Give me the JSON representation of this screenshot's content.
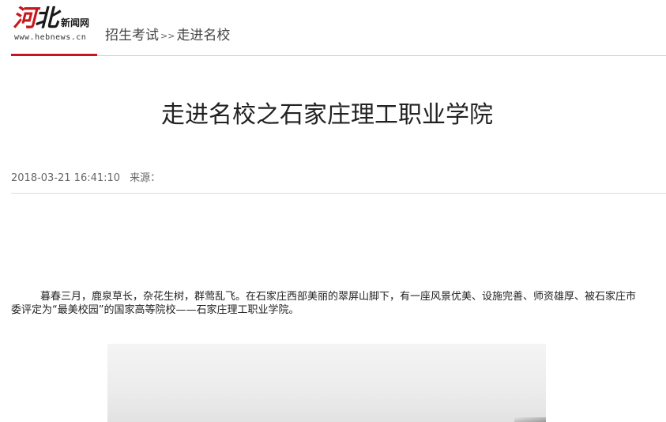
{
  "header": {
    "logo": {
      "mark_part1": "河",
      "mark_part2": "北",
      "sub_label": "新闻网",
      "url": "www.hebnews.cn"
    },
    "breadcrumb": {
      "items": [
        "招生考试",
        "走进名校"
      ],
      "separator": ">>"
    }
  },
  "article": {
    "title": "走进名校之石家庄理工职业学院",
    "date": "2018-03-21 16:41:10",
    "source_label": "来源：",
    "paragraphs": [
      "暮春三月，鹿泉草长，杂花生树，群莺乱飞。在石家庄西部美丽的翠屏山脚下，有一座风景优美、设施完善、师资雄厚、被石家庄市委评定为“最美校园”的国家高等院校——石家庄理工职业学院。"
    ]
  },
  "colors": {
    "brand_red": "#c8161d",
    "divider": "#cccccc",
    "meta_text": "#666666"
  }
}
